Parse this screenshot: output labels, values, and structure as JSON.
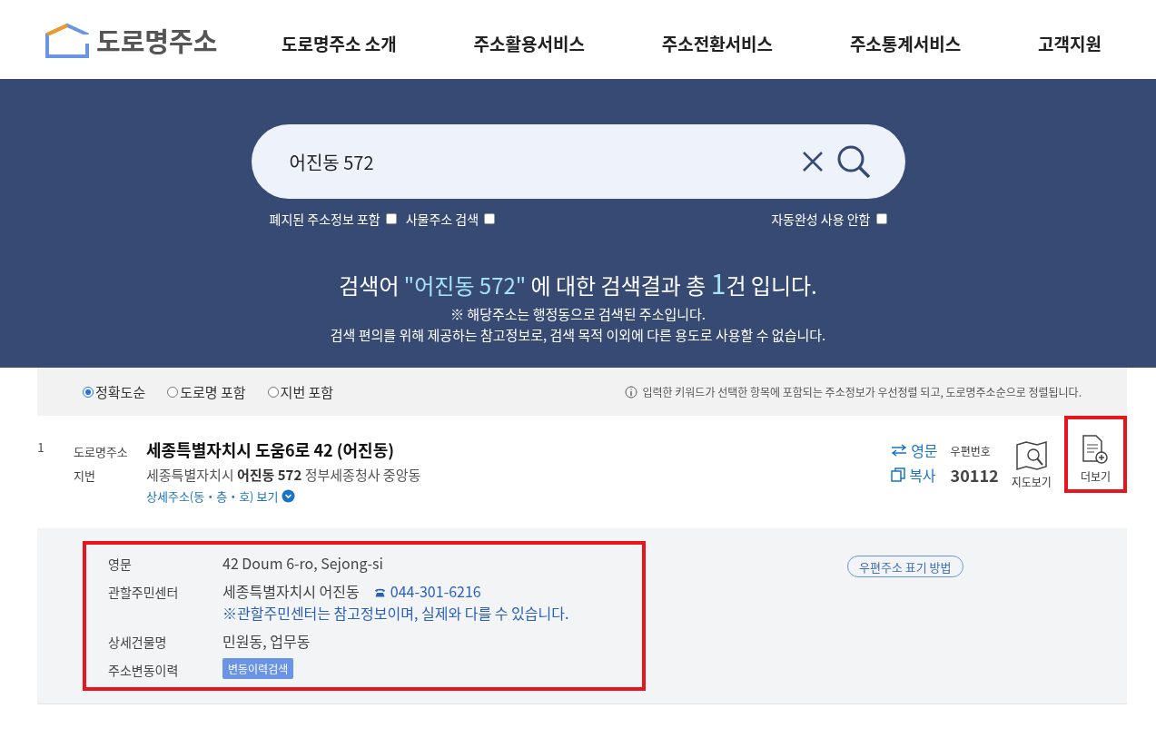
{
  "header": {
    "logo": "도로명주소",
    "nav": [
      {
        "label": "도로명주소 소개"
      },
      {
        "label": "주소활용서비스"
      },
      {
        "label": "주소전환서비스"
      },
      {
        "label": "주소통계서비스"
      },
      {
        "label": "고객지원"
      }
    ]
  },
  "search": {
    "value": "어진동 572",
    "options": [
      {
        "label": "폐지된 주소정보 포함",
        "checked": false
      },
      {
        "label": "사물주소 검색",
        "checked": false
      },
      {
        "label": "자동완성 사용 안함",
        "checked": false
      }
    ],
    "summary": {
      "prefix": "검색어",
      "query": "\"어진동 572\"",
      "middle": "에 대한 검색결과 총",
      "count": "1",
      "suffix": "건 입니다."
    },
    "notes": [
      "※ 해당주소는 행정동으로 검색된 주소입니다.",
      "검색 편의를 위해 제공하는 참고정보로, 검색 목적 이외에 다른 용도로 사용할 수 없습니다."
    ]
  },
  "sort": {
    "options": [
      {
        "label": "정확도순",
        "selected": true
      },
      {
        "label": "도로명 포함",
        "selected": false
      },
      {
        "label": "지번 포함",
        "selected": false
      }
    ],
    "hint": "입력한 키워드가 선택한 항목에 포함되는 주소정보가 우선정렬 되고, 도로명주소순으로 정렬됩니다."
  },
  "result": {
    "index": "1",
    "road_label": "도로명주소",
    "road_address": "세종특별자치시 도움6로 42 (어진동)",
    "jibun_label": "지번",
    "jibun_address": "세종특별자치시 **어진동 572** 정부세종청사 중앙동",
    "detail_link": "상세주소(동・층・호) 보기",
    "english_button": "영문",
    "copy_button": "복사",
    "postal_label": "우편번호",
    "postal_code": "30112",
    "map_button": "지도보기",
    "more_button": "더보기",
    "more_highlighted": true
  },
  "detail": {
    "highlighted": true,
    "rows": [
      {
        "kind": "text",
        "label": "영문",
        "value": "42 Doum 6-ro, Sejong-si"
      },
      {
        "kind": "center",
        "label": "관할주민센터",
        "value": "세종특별자치시 어진동",
        "phone": "044-301-6216",
        "note": "※관할주민센터는 참고정보이며, 실제와 다를 수 있습니다."
      },
      {
        "kind": "text",
        "label": "상세건물명",
        "value": "민원동, 업무동"
      },
      {
        "kind": "button",
        "label": "주소변동이력",
        "value": "변동이력검색"
      }
    ],
    "postal_guide": "우편주소 표기 방법"
  }
}
